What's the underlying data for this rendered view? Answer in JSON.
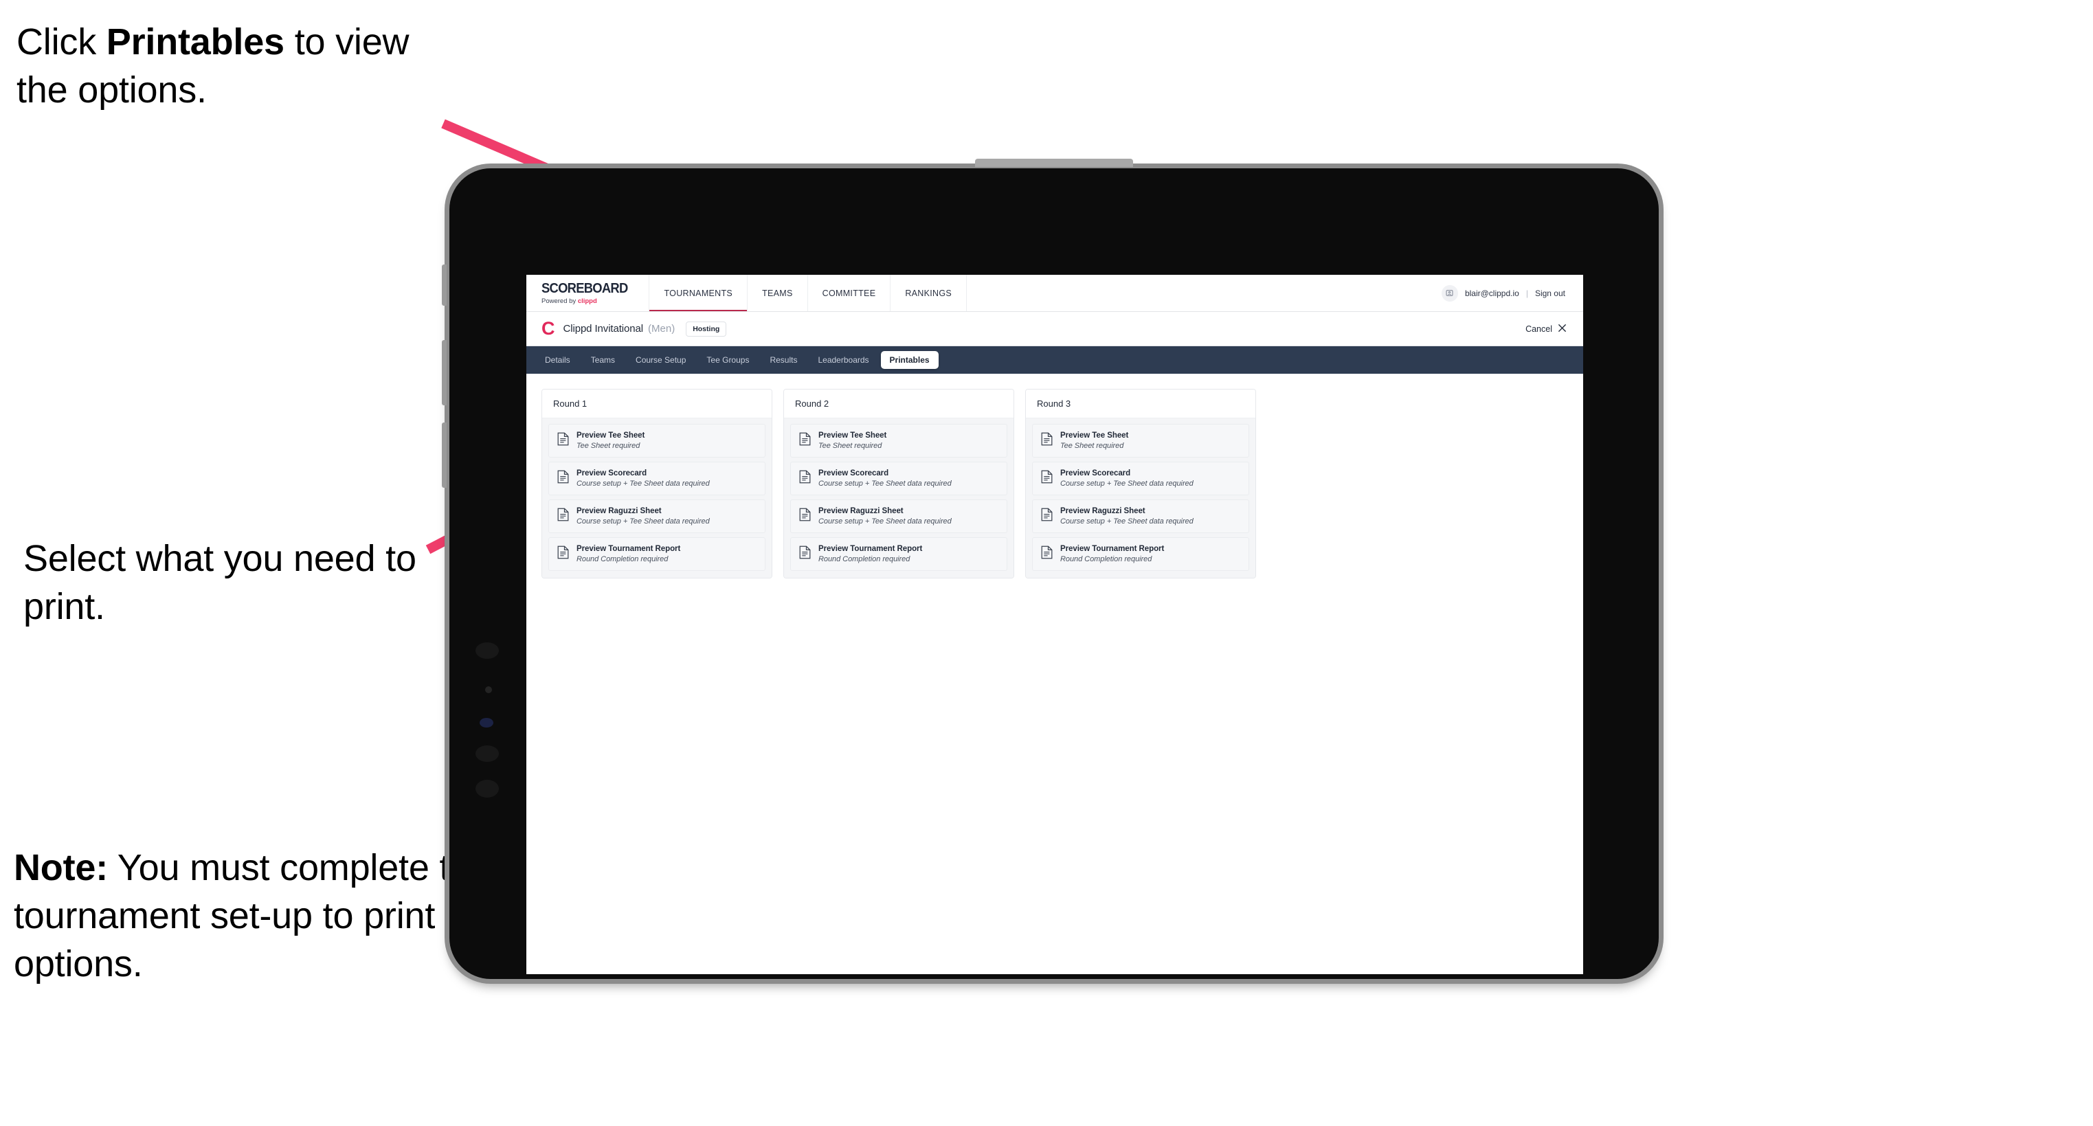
{
  "annotations": {
    "click_printables": {
      "pre": "Click ",
      "bold": "Printables",
      "post": " to view the options."
    },
    "select_print": "Select what you need to print.",
    "note": {
      "bold": "Note:",
      "text": " You must complete the tournament set-up to print all the options."
    }
  },
  "colors": {
    "accent_pink": "#ef3d6b",
    "brand_red": "#e1285a",
    "tabstrip_navy": "#2e3c52",
    "nav_underline": "#b9294c"
  },
  "app": {
    "brand": {
      "title": "SCOREBOARD",
      "powered_prefix": "Powered by ",
      "powered_name": "clippd"
    },
    "nav_links": [
      {
        "label": "TOURNAMENTS",
        "active": true
      },
      {
        "label": "TEAMS",
        "active": false
      },
      {
        "label": "COMMITTEE",
        "active": false
      },
      {
        "label": "RANKINGS",
        "active": false
      }
    ],
    "account": {
      "avatar_icon": "user-avatar-icon",
      "email": "blair@clippd.io",
      "separator": "|",
      "sign_out": "Sign out"
    },
    "tournament_header": {
      "logo_letter": "C",
      "name": "Clippd Invitational",
      "gender": "(Men)",
      "status_badge": "Hosting",
      "cancel_label": "Cancel",
      "cancel_icon": "close-x-icon"
    },
    "tabs": [
      {
        "label": "Details",
        "active": false
      },
      {
        "label": "Teams",
        "active": false
      },
      {
        "label": "Course Setup",
        "active": false
      },
      {
        "label": "Tee Groups",
        "active": false
      },
      {
        "label": "Results",
        "active": false
      },
      {
        "label": "Leaderboards",
        "active": false
      },
      {
        "label": "Printables",
        "active": true
      }
    ],
    "rounds": [
      {
        "title": "Round 1",
        "items": [
          {
            "title": "Preview Tee Sheet",
            "subtitle": "Tee Sheet required"
          },
          {
            "title": "Preview Scorecard",
            "subtitle": "Course setup + Tee Sheet data required"
          },
          {
            "title": "Preview Raguzzi Sheet",
            "subtitle": "Course setup + Tee Sheet data required"
          },
          {
            "title": "Preview Tournament Report",
            "subtitle": "Round Completion required"
          }
        ]
      },
      {
        "title": "Round 2",
        "items": [
          {
            "title": "Preview Tee Sheet",
            "subtitle": "Tee Sheet required"
          },
          {
            "title": "Preview Scorecard",
            "subtitle": "Course setup + Tee Sheet data required"
          },
          {
            "title": "Preview Raguzzi Sheet",
            "subtitle": "Course setup + Tee Sheet data required"
          },
          {
            "title": "Preview Tournament Report",
            "subtitle": "Round Completion required"
          }
        ]
      },
      {
        "title": "Round 3",
        "items": [
          {
            "title": "Preview Tee Sheet",
            "subtitle": "Tee Sheet required"
          },
          {
            "title": "Preview Scorecard",
            "subtitle": "Course setup + Tee Sheet data required"
          },
          {
            "title": "Preview Raguzzi Sheet",
            "subtitle": "Course setup + Tee Sheet data required"
          },
          {
            "title": "Preview Tournament Report",
            "subtitle": "Round Completion required"
          }
        ]
      }
    ]
  }
}
